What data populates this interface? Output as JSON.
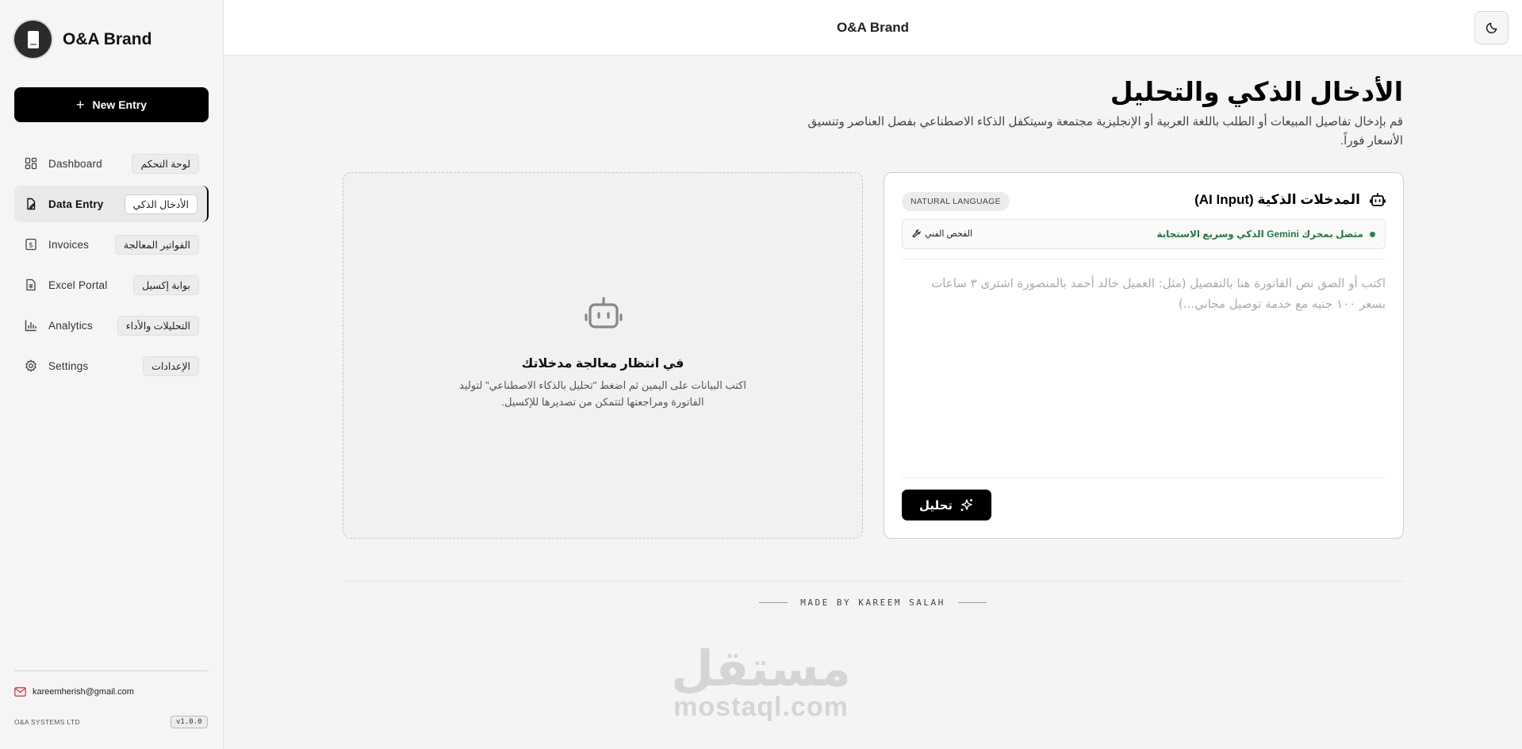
{
  "brand": {
    "name": "O&A Brand"
  },
  "header": {
    "title": "O&A Brand"
  },
  "sidebar": {
    "new_entry_label": "New Entry",
    "items": [
      {
        "label": "Dashboard",
        "badge": "لوحة التحكم",
        "icon": "dashboard-icon"
      },
      {
        "label": "Data Entry",
        "badge": "الأدخال الذكي",
        "icon": "data-entry-icon",
        "active": true
      },
      {
        "label": "Invoices",
        "badge": "الفواتير المعالجة",
        "icon": "invoice-icon"
      },
      {
        "label": "Excel Portal",
        "badge": "بوابة إكسيل",
        "icon": "spreadsheet-icon"
      },
      {
        "label": "Analytics",
        "badge": "التحليلات والأداء",
        "icon": "chart-icon"
      },
      {
        "label": "Settings",
        "badge": "الإعدادات",
        "icon": "gear-icon"
      }
    ],
    "email": "kareemherish@gmail.com",
    "company": "O&A SYSTEMS LTD",
    "version": "v1.0.0"
  },
  "main": {
    "title": "الأدخال الذكي والتحليل",
    "description": "قم بإدخال تفاصيل المبيعات أو الطلب باللغة العربية أو الإنجليزية مجتمعة وسيتكفل الذكاء الاصطناعي بفصل العناصر وتنسيق الأسعار فوراً.",
    "ai_card": {
      "title": "المدخلات الذكية (AI Input)",
      "badge": "NATURAL LANGUAGE",
      "status": "متصل بمحرك Gemini الذكي وسريع الاستجابة",
      "tech_check": "الفحص الفني",
      "placeholder": "اكتب أو الصق نص الفاتورة هنا بالتفصيل (مثل: العميل خالد أحمد بالمنصورة اشترى ٣ ساعات بسعر ١٠٠ جنيه مع خدمة توصيل مجاني...)",
      "analyze_label": "تحليل"
    },
    "waiting_card": {
      "title": "في انتظار معالجة مدخلاتك",
      "description": "اكتب البيانات على اليمين ثم اضغط \"تحليل بالذكاء الاصطناعي\" لتوليد الفاتورة ومراجعتها لتتمكن من تصديرها للإكسيل."
    }
  },
  "footer": {
    "made_by": "MADE BY KAREEM SALAH"
  },
  "watermark": {
    "arabic": "مستقل",
    "latin": "mostaql.com"
  }
}
